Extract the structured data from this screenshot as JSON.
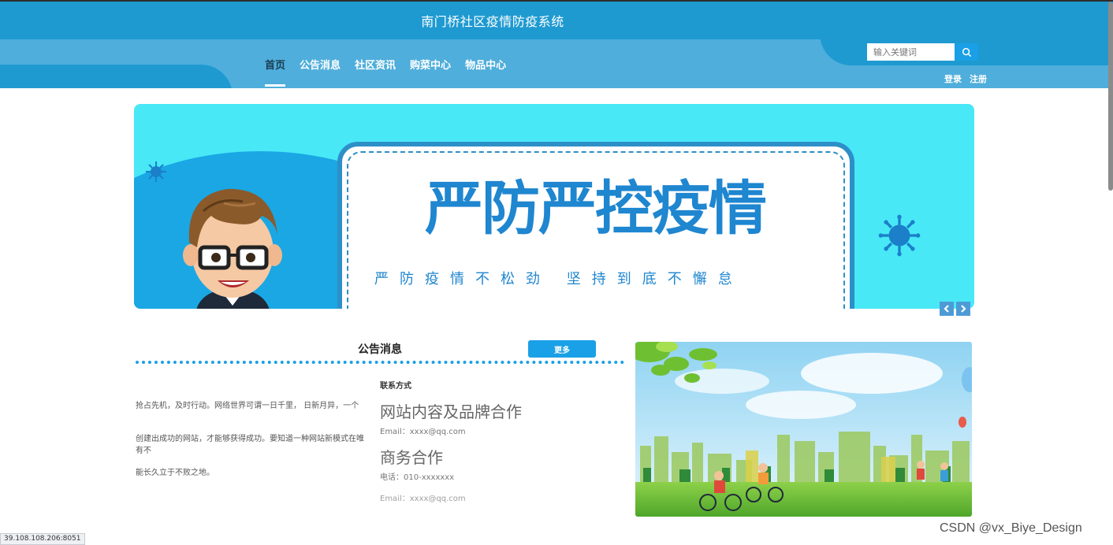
{
  "header": {
    "site_title": "南门桥社区疫情防疫系统",
    "nav": [
      {
        "label": "首页",
        "active": true
      },
      {
        "label": "公告消息",
        "active": false
      },
      {
        "label": "社区资讯",
        "active": false
      },
      {
        "label": "购菜中心",
        "active": false
      },
      {
        "label": "物品中心",
        "active": false
      }
    ],
    "search": {
      "placeholder": "输入关键词",
      "icon": "search-icon"
    },
    "auth": {
      "login": "登录",
      "register": "注册"
    }
  },
  "banner": {
    "main": "严防严控疫情",
    "sub": "严防疫情不松劲 坚持到底不懈怠",
    "prev_icon": "chevron-left-icon",
    "next_icon": "chevron-right-icon"
  },
  "notice": {
    "title": "公告消息",
    "more_label": "更多",
    "paragraphs": [
      "抢占先机，及时行动。网络世界可谓一日千里， 日新月异，一个",
      "创建出成功的网站，才能够获得成功。要知道一种网站新模式在唯有不",
      "能长久立于不败之地。"
    ]
  },
  "contact": {
    "heading": "联系方式",
    "sections": [
      {
        "title": "网站内容及品牌合作",
        "line": "Email：xxxx@qq.com"
      },
      {
        "title": "商务合作",
        "line": "电话：010-xxxxxxx"
      }
    ],
    "extra_line": "Email：xxxx@qq.com"
  },
  "browser": {
    "status_url": "39.108.108.206:8051",
    "watermark": "CSDN @vx_Biye_Design"
  },
  "colors": {
    "header_dark": "#1f9ad1",
    "header_light": "#4faedb",
    "accent": "#1aa0e6",
    "banner_bg": "#48e8f7",
    "slogan": "#1f86d0"
  }
}
